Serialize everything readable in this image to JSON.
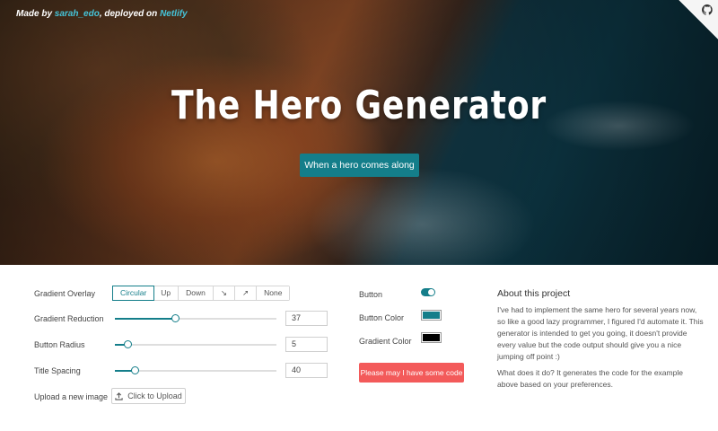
{
  "hero": {
    "credit_prefix": "Made by ",
    "credit_author": "sarah_edo",
    "credit_middle": ", deployed on ",
    "credit_host": "Netlify",
    "title": "The Hero Generator",
    "button_label": "When a hero comes along"
  },
  "controls": {
    "gradient_overlay": {
      "label": "Gradient Overlay",
      "options": [
        "Circular",
        "Up",
        "Down",
        "↘",
        "↗",
        "None"
      ],
      "selected": "Circular"
    },
    "gradient_reduction": {
      "label": "Gradient Reduction",
      "value": "37",
      "fraction": 0.37
    },
    "button_radius": {
      "label": "Button Radius",
      "value": "5",
      "fraction": 0.08
    },
    "title_spacing": {
      "label": "Title Spacing",
      "value": "40",
      "fraction": 0.12
    },
    "upload": {
      "label": "Upload a new image",
      "button_label": "Click to Upload"
    },
    "button_toggle": {
      "label": "Button",
      "on": true
    },
    "button_color": {
      "label": "Button Color",
      "color": "#147e8a"
    },
    "gradient_color": {
      "label": "Gradient Color",
      "color": "#000000"
    },
    "code_button_label": "Please may I have some code"
  },
  "about": {
    "title": "About this project",
    "paragraph1": "I've had to implement the same hero for several years now, so like a good lazy programmer, I figured I'd automate it. This generator is intended to get you going, it doesn't provide every value but the code output should give you a nice jumping off point :)",
    "paragraph2": "What does it do? It generates the code for the example above based on your preferences."
  },
  "colors": {
    "accent": "#147e8a",
    "danger": "#f35a5a",
    "link": "#45c4d9"
  }
}
